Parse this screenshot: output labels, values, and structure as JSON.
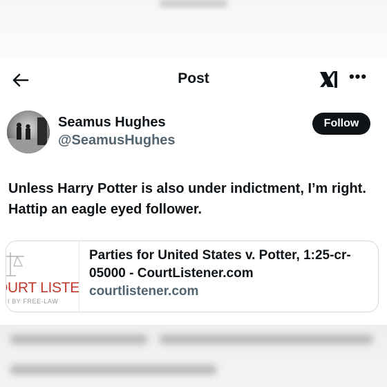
{
  "header": {
    "title": "Post",
    "back_icon": "arrow-left-icon",
    "logo_icon": "xai-logo",
    "more_icon": "more-icon",
    "more_label": "•••"
  },
  "author": {
    "name": "Seamus Hughes",
    "handle": "@SeamusHughes",
    "follow_label": "Follow"
  },
  "tweet": {
    "text": "Unless Harry Potter is also under indictment, I’m right. Hattip an eagle eyed follower."
  },
  "link_card": {
    "title": "Parties for United States v. Potter, 1:25-cr-05000 - CourtListener.com",
    "domain": "courtlistener.com",
    "thumbnail_brand": "OURT LISTE",
    "thumbnail_sub": "I BY FREE-LAW"
  },
  "colors": {
    "text": "#0f1419",
    "secondary": "#536471",
    "follow_bg": "#0f1419",
    "brand_red": "#c0392b"
  }
}
